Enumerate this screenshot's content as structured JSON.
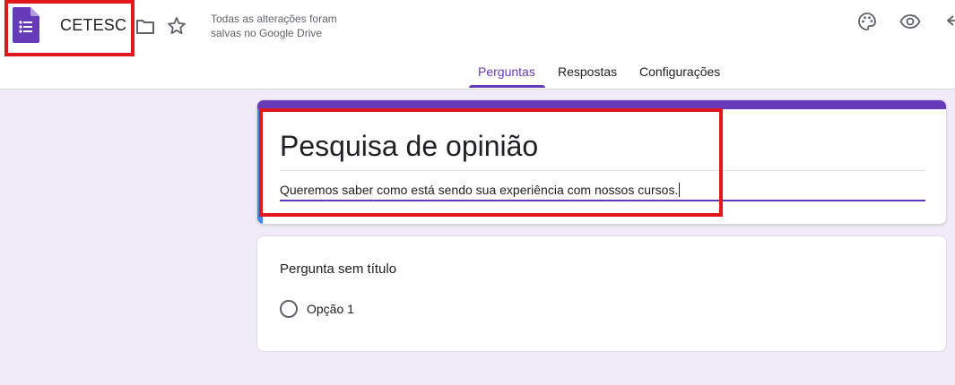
{
  "app": {
    "doc_title": "CETESC",
    "save_status": "Todas as alterações foram salvas no Google Drive",
    "logo_icon": "google-forms-icon",
    "accent_color": "#673ab7"
  },
  "header_actions": {
    "icons": [
      "folder-icon",
      "star-icon",
      "palette-icon",
      "preview-icon",
      "undo-icon"
    ]
  },
  "tabs": [
    {
      "label": "Perguntas",
      "active": true
    },
    {
      "label": "Respostas",
      "active": false
    },
    {
      "label": "Configurações",
      "active": false
    }
  ],
  "form": {
    "title": "Pesquisa de opinião",
    "description": "Queremos saber como está sendo sua experiência com nossos cursos."
  },
  "question": {
    "title": "Pergunta sem título",
    "options": [
      "Opção 1"
    ]
  }
}
